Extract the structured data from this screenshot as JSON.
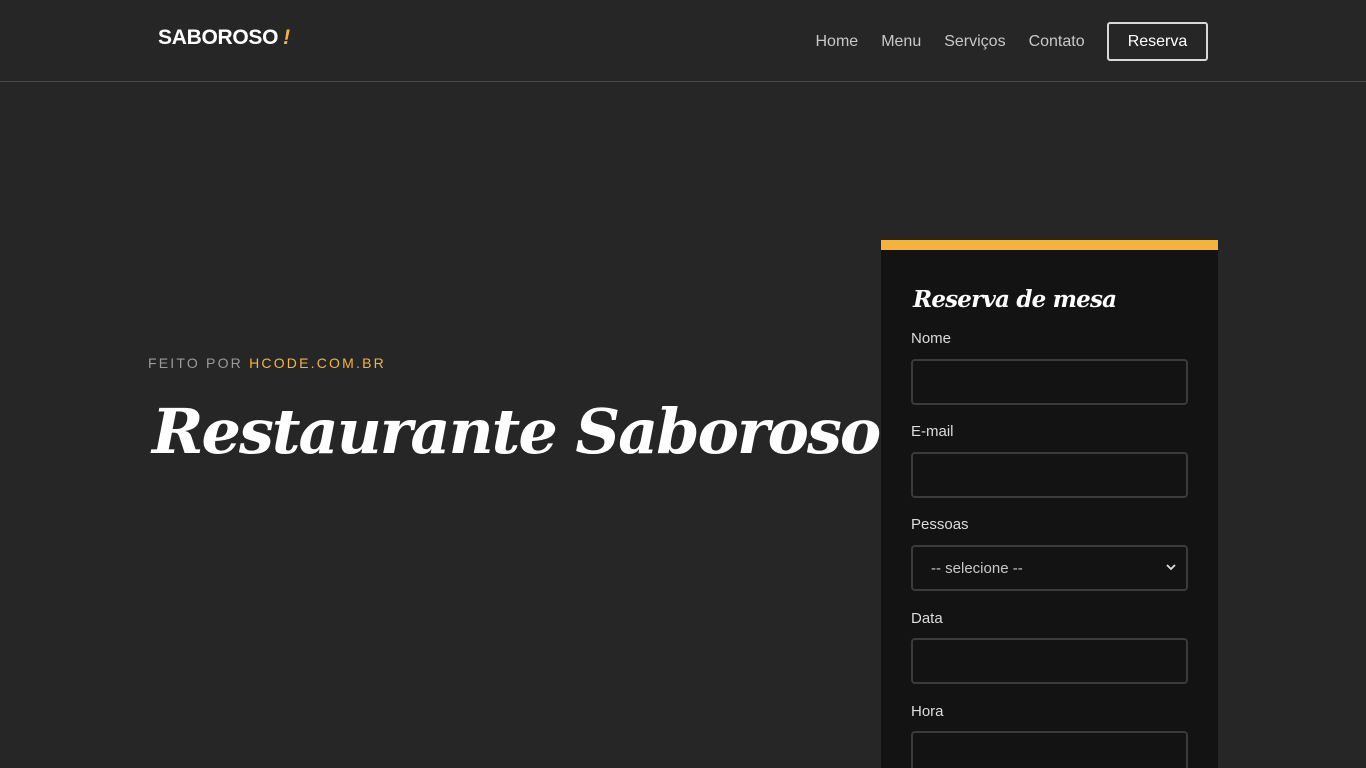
{
  "navbar": {
    "brand_text": "SABOROSO",
    "brand_accent": "!",
    "links": [
      {
        "label": "Home"
      },
      {
        "label": "Menu"
      },
      {
        "label": "Serviços"
      },
      {
        "label": "Contato"
      }
    ],
    "reserve_label": "Reserva"
  },
  "hero": {
    "made_by_prefix": "FEITO POR",
    "made_by_link": "HCODE.COM.BR",
    "title": "Restaurante Saboroso!"
  },
  "reservation_form": {
    "title": "Reserva de mesa",
    "fields": {
      "name": {
        "label": "Nome",
        "value": "",
        "placeholder": ""
      },
      "email": {
        "label": "E-mail",
        "value": "",
        "placeholder": ""
      },
      "people": {
        "label": "Pessoas",
        "selected": "-- selecione --"
      },
      "date": {
        "label": "Data",
        "value": "",
        "placeholder": ""
      },
      "time": {
        "label": "Hora",
        "value": "",
        "placeholder": ""
      }
    }
  },
  "colors": {
    "background": "#262626",
    "accent": "#f7b23b",
    "card": "#131313"
  },
  "icons": {
    "select_chevron": "chevron-down-icon"
  }
}
